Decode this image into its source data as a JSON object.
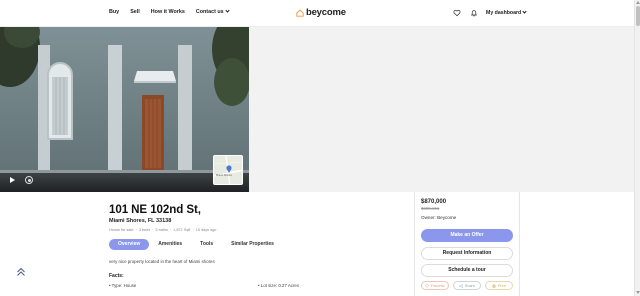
{
  "nav": {
    "buy": "Buy",
    "sell": "Sell",
    "how_it_works": "How it Works",
    "contact_us": "Contact us"
  },
  "brand": {
    "name": "beycome",
    "accent": "#f2994a"
  },
  "header": {
    "dashboard": "My dashboard",
    "icons": [
      "heart-icon",
      "bell-icon"
    ]
  },
  "hero": {
    "icons": [
      "play-icon",
      "camera-icon",
      "map-thumbnail"
    ],
    "map_caption": "Miami Shores"
  },
  "listing": {
    "title": "101 NE 102nd St,",
    "city": "Miami Shores, FL 33138",
    "meta": [
      "House for sale",
      "·",
      "3 beds",
      "·",
      "3 baths",
      "·",
      "1,872 Sqft",
      "·",
      "15 days ago"
    ],
    "description": "very nice property located in the heart of Miami shores",
    "facts_heading": "Facts:",
    "fact_type": "• Type: House",
    "fact_lot": "• Lot size: 0.27 Acres"
  },
  "tabs": [
    "Overview",
    "Amenities",
    "Tools",
    "Similar Properties"
  ],
  "panel": {
    "price": "$870,000",
    "old_price": "$885,191",
    "owner": "Owner: Beycome",
    "offer_button": "Make an Offer",
    "info_button": "Request Information",
    "tour_button": "Schedule a tour",
    "chips": [
      "Favorite",
      "Share",
      "Print"
    ]
  },
  "colors": {
    "primary": "#8a97ec",
    "favorite": "#e89a84",
    "share": "#88aaaa",
    "print": "#d8a860"
  }
}
